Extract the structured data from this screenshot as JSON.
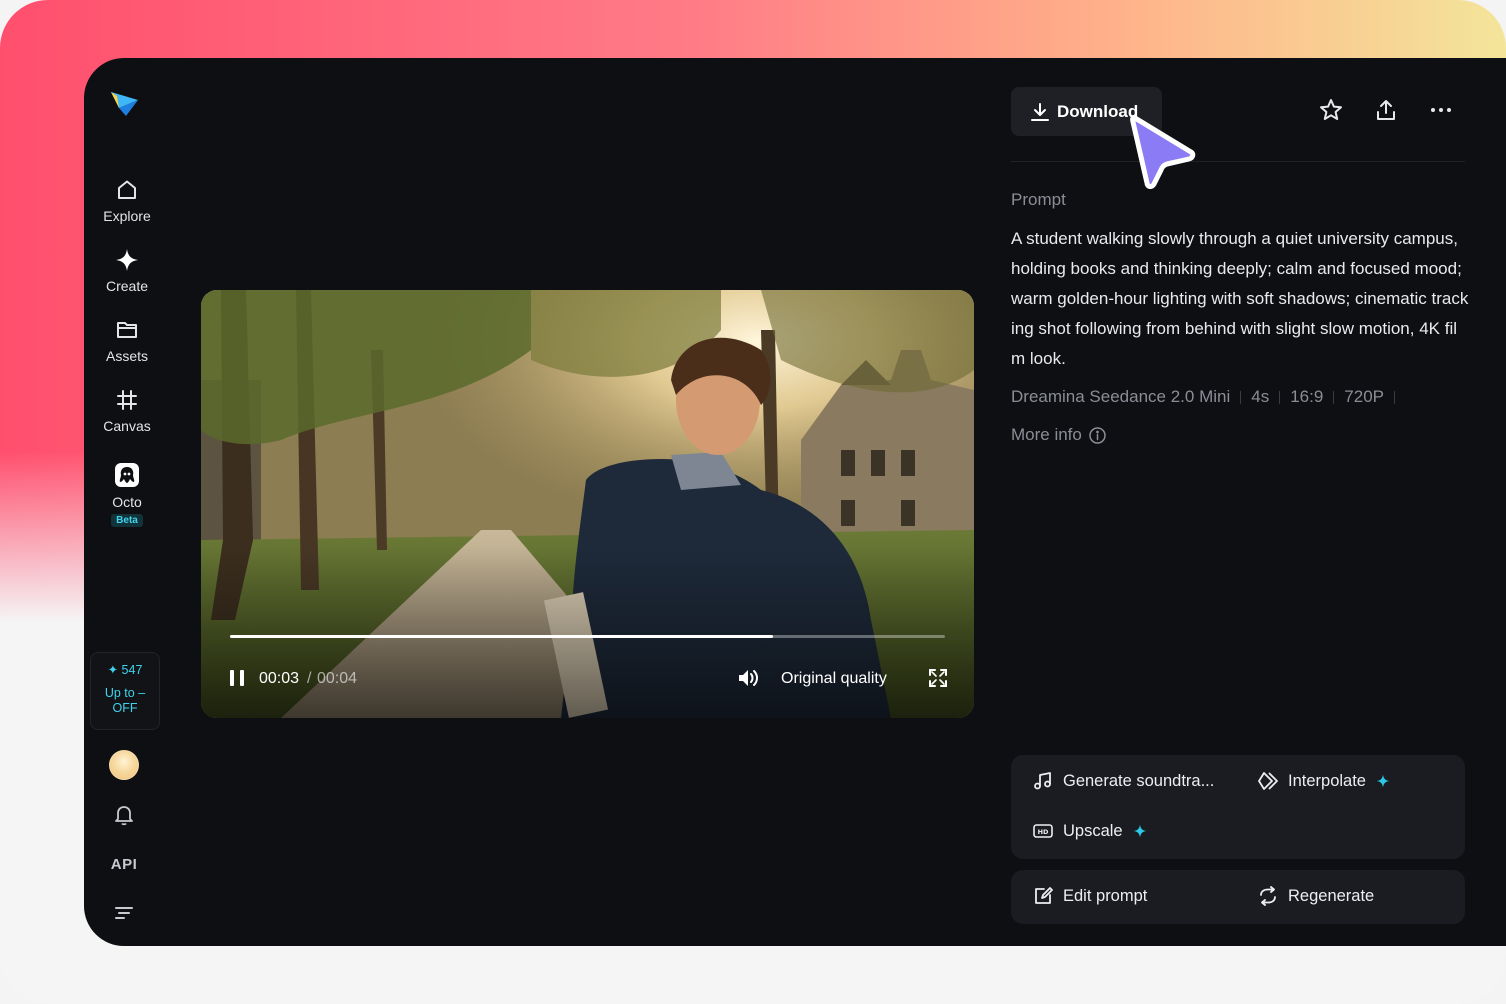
{
  "sidebar": {
    "items": [
      {
        "label": "Explore",
        "icon": "home-icon"
      },
      {
        "label": "Create",
        "icon": "sparkle-icon"
      },
      {
        "label": "Assets",
        "icon": "folder-icon"
      },
      {
        "label": "Canvas",
        "icon": "canvas-grid-icon"
      },
      {
        "label": "Octo",
        "icon": "octo-icon",
        "badge": "Beta"
      }
    ],
    "credits": {
      "count": "✦ 547",
      "promo": "Up to –\nOFF"
    },
    "api_label": "API"
  },
  "video": {
    "current_time": "00:03",
    "separator": "/",
    "total_time": "00:04",
    "progress_fraction": 0.76,
    "quality_label": "Original quality"
  },
  "toolbar": {
    "download_label": "Download"
  },
  "details": {
    "prompt_label": "Prompt",
    "prompt_text": "A student walking slowly through a quiet university campus, holding books and thinking deeply; calm and focused mood; warm golden-hour lighting with soft shadows; cinematic tracking shot following from behind with slight slow motion, 4K film look.",
    "meta": [
      "Dreamina Seedance 2.0 Mini",
      "4s",
      "16:9",
      "720P"
    ],
    "more_info_label": "More info"
  },
  "actions": {
    "generate_soundtrack": "Generate soundtra...",
    "interpolate": "Interpolate",
    "upscale": "Upscale",
    "edit_prompt": "Edit prompt",
    "regenerate": "Regenerate"
  },
  "colors": {
    "accent_cyan": "#2cc8e6",
    "panel_bg": "#0e0f12",
    "card_bg": "#1b1c21",
    "cursor_purple": "#8b7cf6"
  }
}
